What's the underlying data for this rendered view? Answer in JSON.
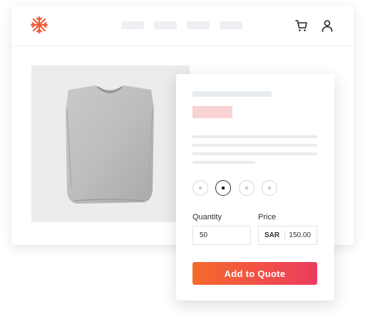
{
  "brand": {
    "logo_icon": "snowflake-logo-icon",
    "accent_color": "#ef5a36"
  },
  "header": {
    "cart_icon": "cart-icon",
    "account_icon": "user-icon"
  },
  "product": {
    "image_icon": "folded-tshirt-image",
    "swatches": [
      {
        "selected": false
      },
      {
        "selected": true
      },
      {
        "selected": false
      },
      {
        "selected": false
      }
    ]
  },
  "form": {
    "quantity_label": "Quantity",
    "quantity_value": "50",
    "price_label": "Price",
    "currency": "SAR",
    "price_value": "150.00",
    "cta_label": "Add to Quote"
  },
  "colors": {
    "cta_gradient_start": "#f46a2c",
    "cta_gradient_end": "#ec3b5e",
    "price_tag_placeholder": "#f9d2d4",
    "placeholder": "#e9ecef"
  }
}
